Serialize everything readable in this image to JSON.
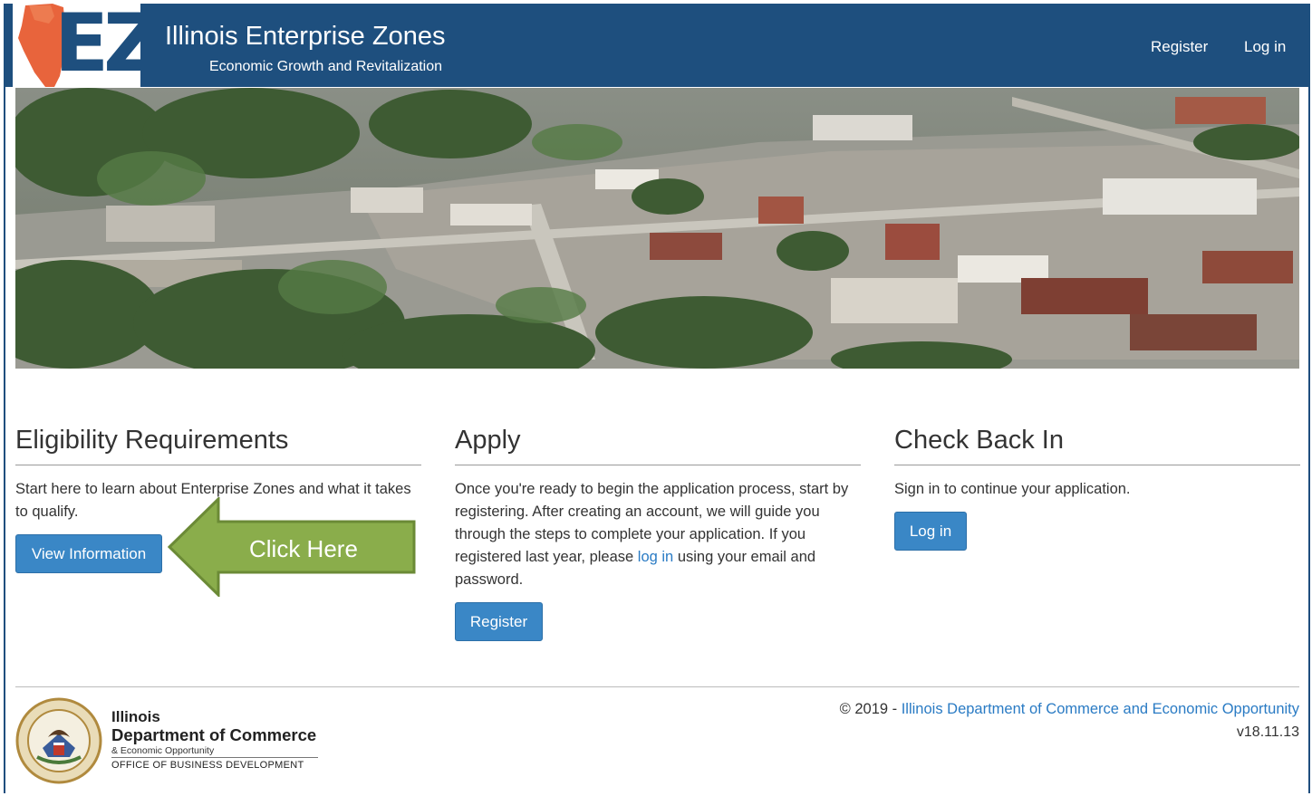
{
  "header": {
    "logo_text": "EZ",
    "title": "Illinois Enterprise Zones",
    "subtitle": "Economic Growth and Revitalization",
    "nav": {
      "register": "Register",
      "login": "Log in"
    }
  },
  "hero": {
    "image": "aerial-town-photo"
  },
  "columns": {
    "eligibility": {
      "heading": "Eligibility Requirements",
      "text": "Start here to learn about Enterprise Zones and what it takes to qualify.",
      "button": "View Information"
    },
    "apply": {
      "heading": "Apply",
      "text_before_link": "Once you're ready to begin the application process, start by registering. After creating an account, we will guide you through the steps to complete your application. If you registered last year, please ",
      "link": "log in",
      "text_after_link": " using your email and password.",
      "button": "Register"
    },
    "check_back": {
      "heading": "Check Back In",
      "text": "Sign in to continue your application.",
      "button": "Log in"
    }
  },
  "callout": {
    "label": "Click Here",
    "color": "#8aad4b"
  },
  "footer": {
    "dept_line1": "Illinois",
    "dept_line2": "Department of Commerce",
    "dept_line3": "& Economic Opportunity",
    "dept_line4": "OFFICE OF BUSINESS DEVELOPMENT",
    "copyright_prefix": "© 2019 - ",
    "copyright_link": "Illinois Department of Commerce and Economic Opportunity",
    "version": "v18.11.13"
  },
  "colors": {
    "navbar": "#1e4f7e",
    "button": "#3a87c6",
    "link": "#2a7bc4"
  }
}
